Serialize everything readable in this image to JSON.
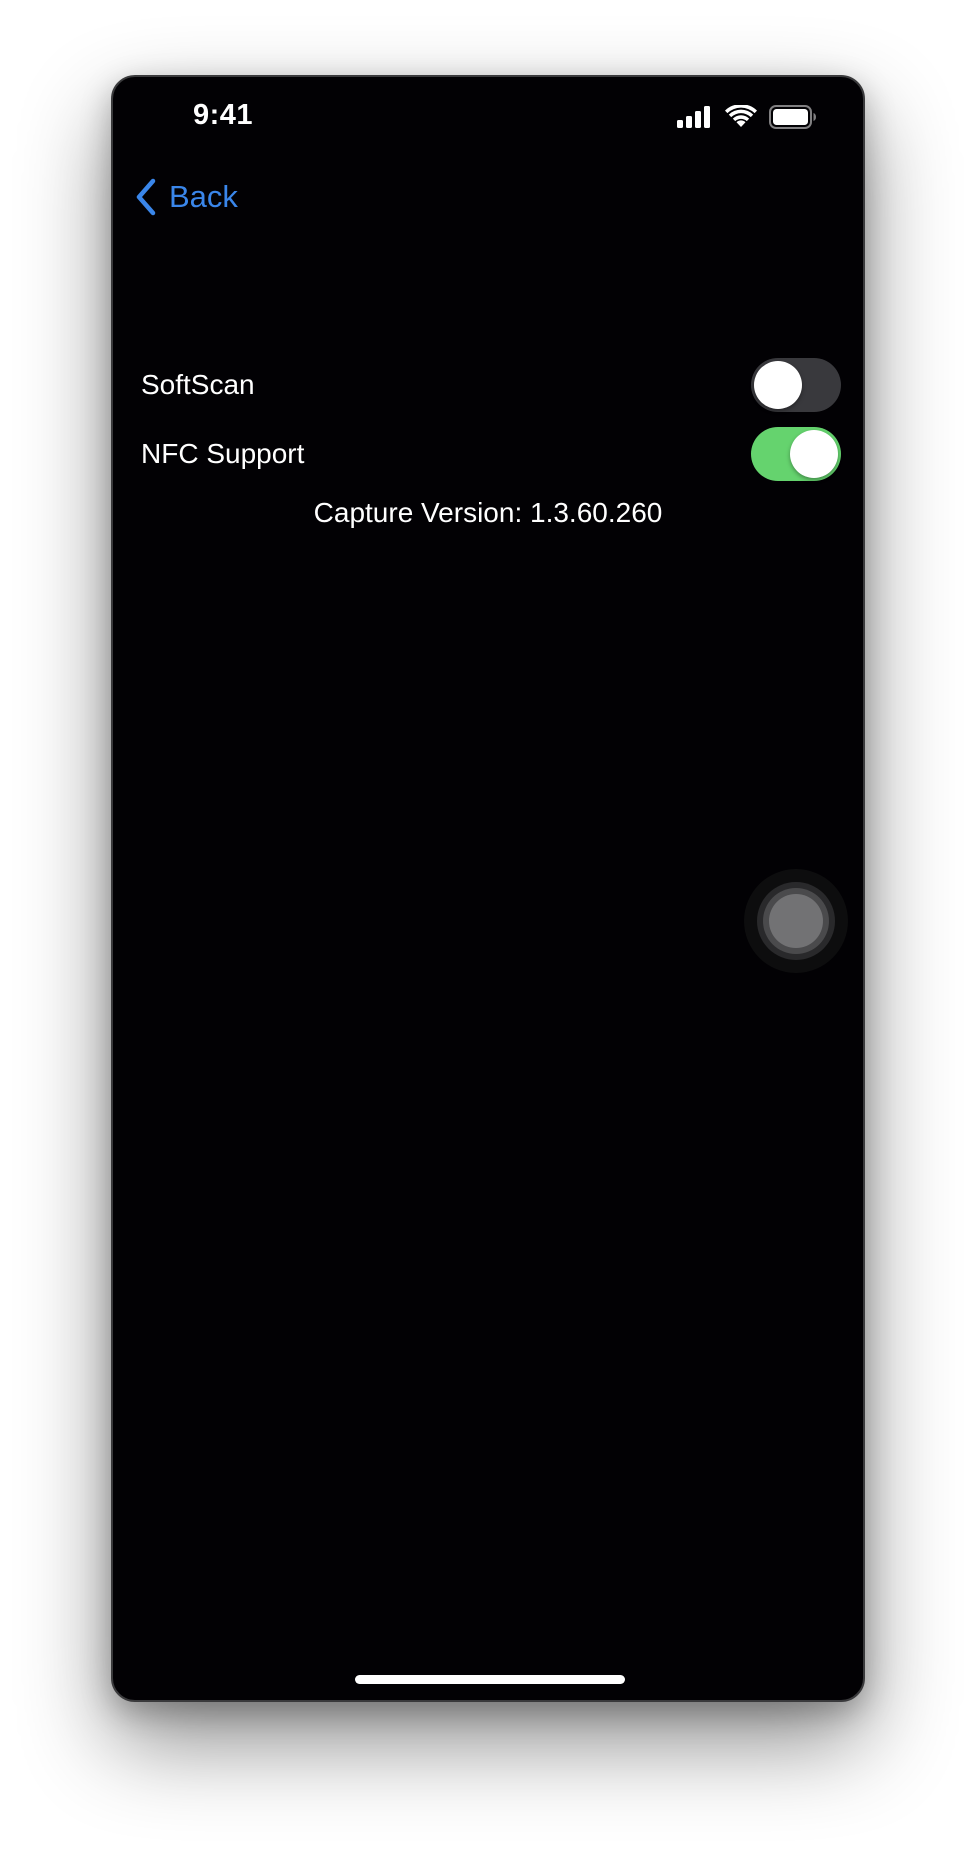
{
  "status_bar": {
    "time": "9:41",
    "icons": [
      "cellular-signal-icon",
      "wifi-icon",
      "battery-icon"
    ]
  },
  "nav": {
    "back_label": "Back",
    "back_icon": "chevron-left-icon"
  },
  "settings": {
    "items": [
      {
        "label": "SoftScan",
        "enabled": false
      },
      {
        "label": "NFC Support",
        "enabled": true
      }
    ],
    "version_text": "Capture Version: 1.3.60.260"
  },
  "colors": {
    "background": "#020104",
    "accent_blue": "#3a86ea",
    "toggle_on": "#65d36e",
    "toggle_off": "#39393d"
  },
  "overlay": {
    "assistive_touch_icon": "assistive-touch-icon"
  }
}
